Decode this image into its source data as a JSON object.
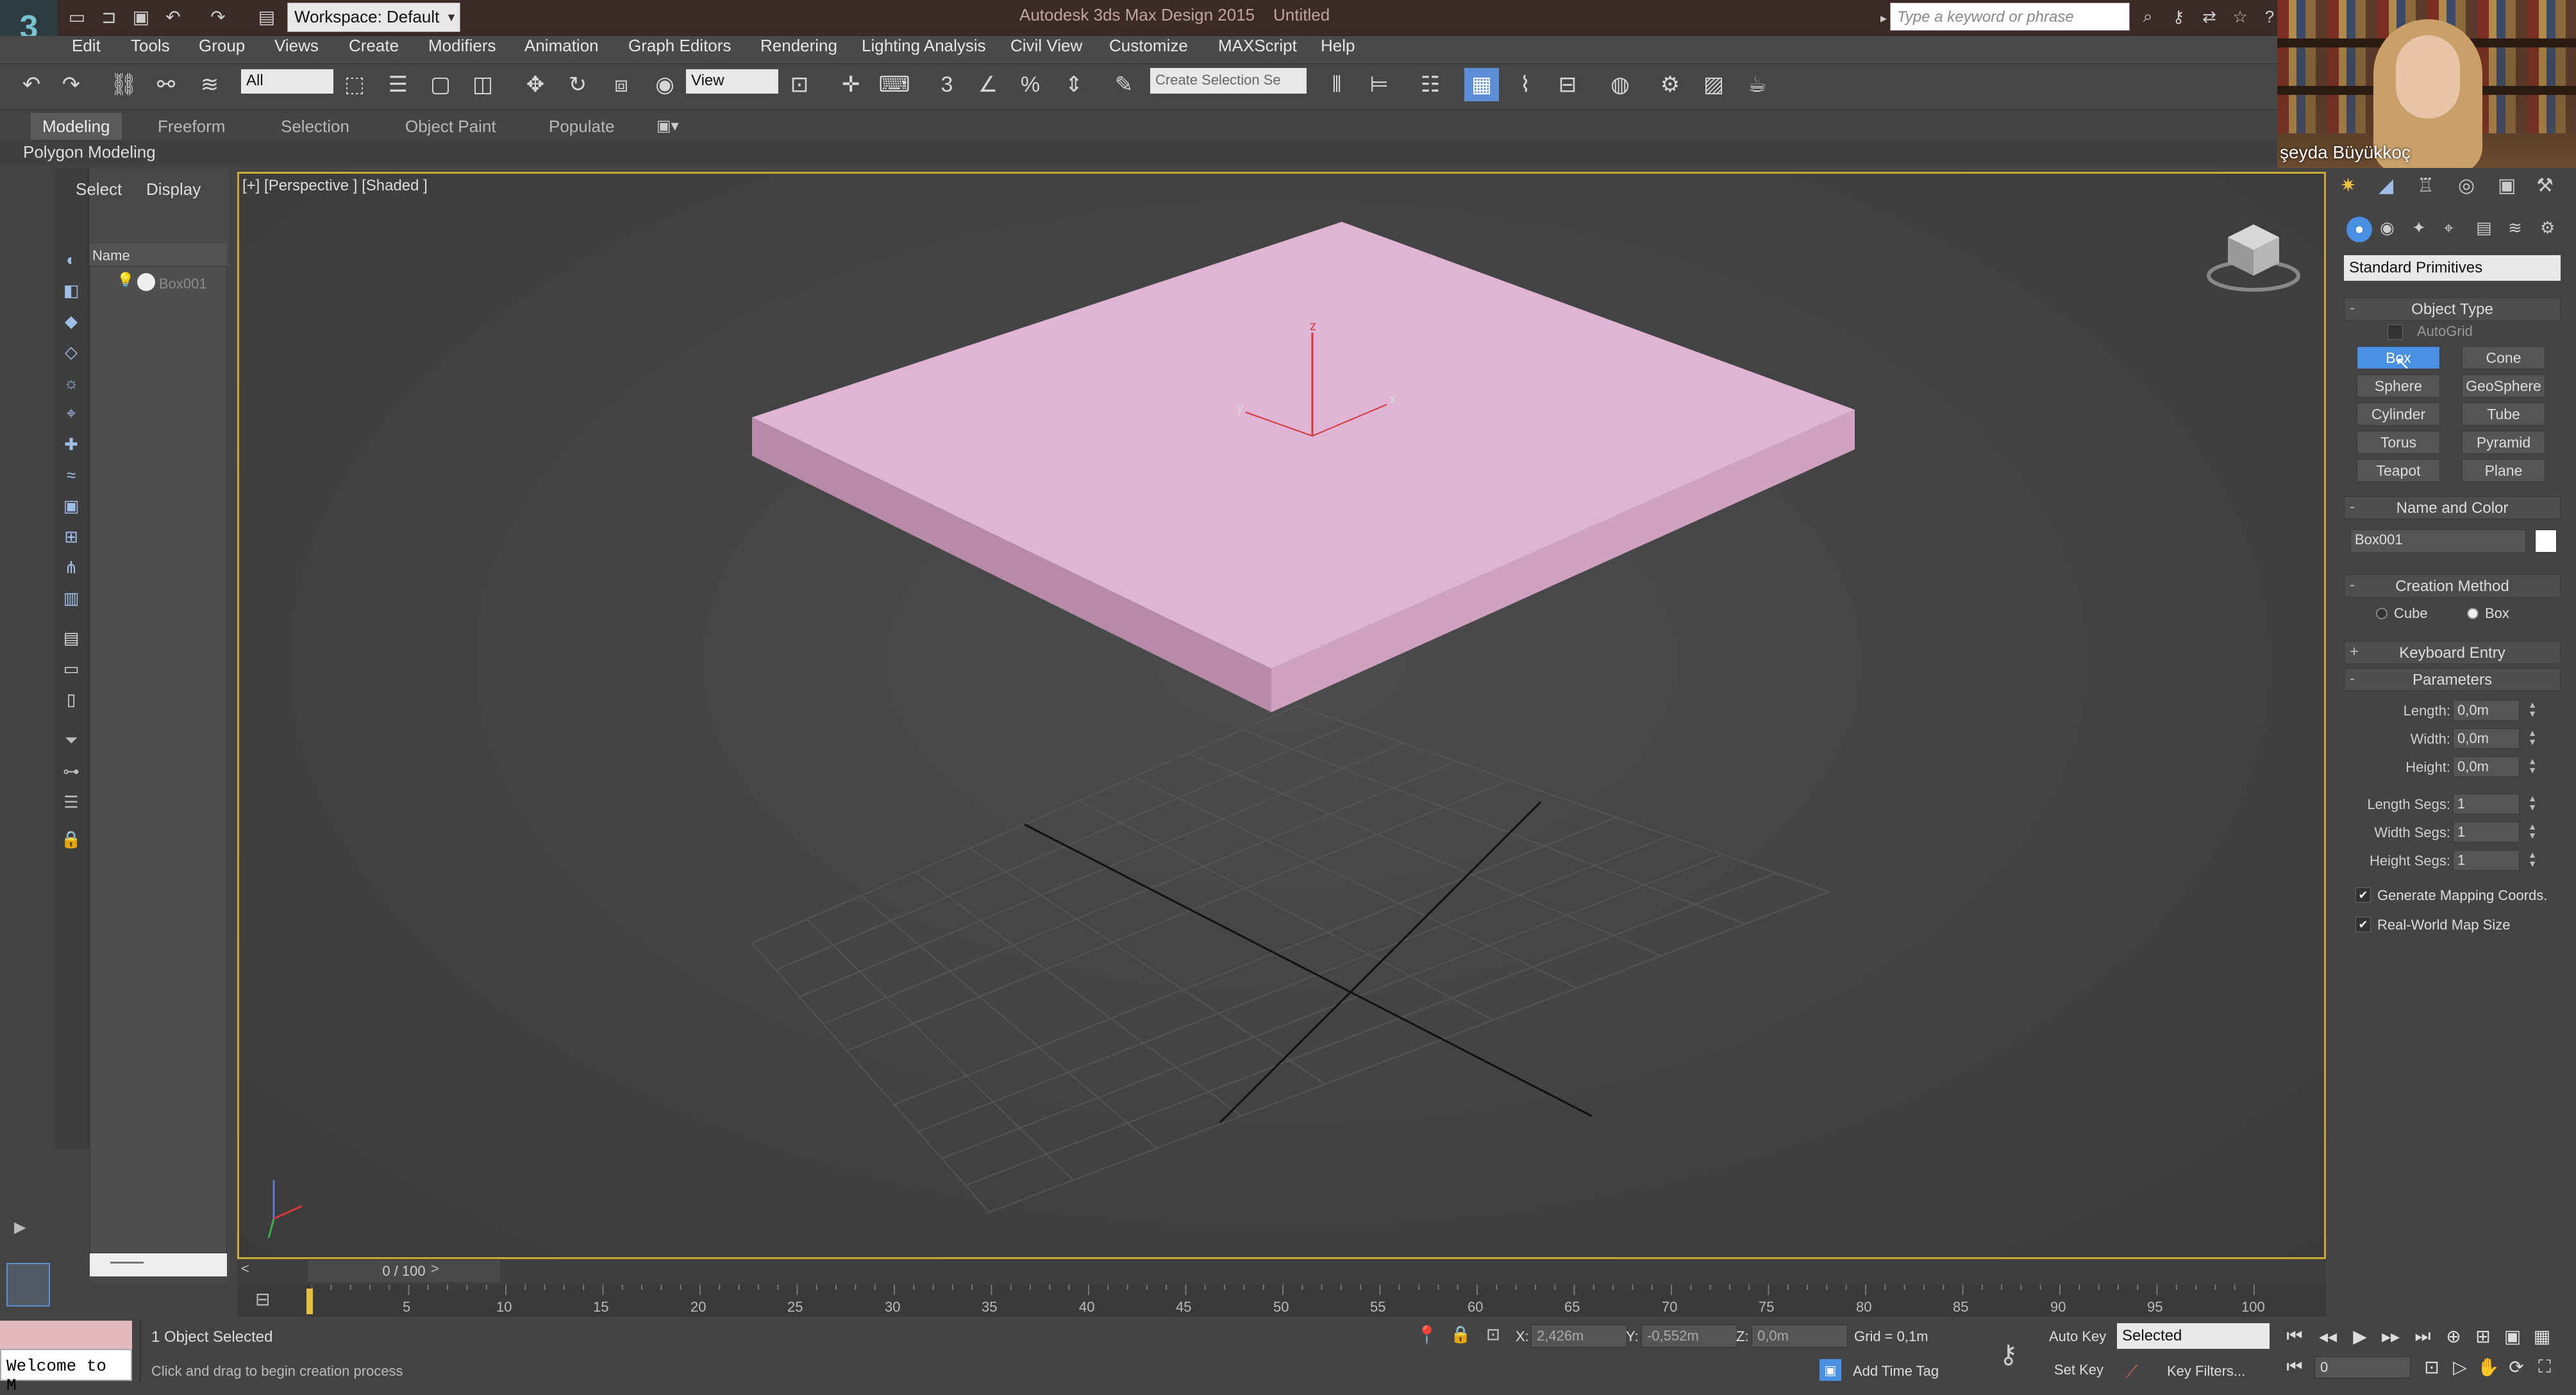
{
  "titlebar": {
    "app_title": "Autodesk 3ds Max Design 2015",
    "file_name": "Untitled",
    "workspace": "Workspace: Default",
    "search_placeholder": "Type a keyword or phrase"
  },
  "menu": [
    "Edit",
    "Tools",
    "Group",
    "Views",
    "Create",
    "Modifiers",
    "Animation",
    "Graph Editors",
    "Rendering",
    "Lighting Analysis",
    "Civil View",
    "Customize",
    "MAXScript",
    "Help"
  ],
  "toolbar": {
    "selection_filter": "All",
    "reference_coord": "View",
    "create_selection_set": "Create Selection Se",
    "snap_value": "3"
  },
  "ribbon": {
    "tabs": [
      "Modeling",
      "Freeform",
      "Selection",
      "Object Paint",
      "Populate"
    ],
    "panel_label": "Polygon Modeling"
  },
  "webcam": {
    "name": "şeyda Büyükkoç"
  },
  "scene_explorer": {
    "tab_select": "Select",
    "tab_display": "Display",
    "column_name": "Name",
    "objects": [
      "Box001"
    ]
  },
  "viewport": {
    "label": "[+] [Perspective ] [Shaded ]",
    "axis_x": "x",
    "axis_y": "y",
    "axis_z": "z",
    "object_color": "#e0b4d4"
  },
  "command_panel": {
    "category": "Standard Primitives",
    "object_type_title": "Object Type",
    "autogrid": "AutoGrid",
    "primitives": [
      "Box",
      "Cone",
      "Sphere",
      "GeoSphere",
      "Cylinder",
      "Tube",
      "Torus",
      "Pyramid",
      "Teapot",
      "Plane"
    ],
    "active_primitive": "Box",
    "name_color_title": "Name and Color",
    "object_name": "Box001",
    "creation_method_title": "Creation Method",
    "creation_cube": "Cube",
    "creation_box": "Box",
    "keyboard_entry_title": "Keyboard Entry",
    "parameters_title": "Parameters",
    "params": [
      {
        "label": "Length:",
        "value": "0,0m"
      },
      {
        "label": "Width:",
        "value": "0,0m"
      },
      {
        "label": "Height:",
        "value": "0,0m"
      },
      {
        "label": "Length Segs:",
        "value": "1"
      },
      {
        "label": "Width Segs:",
        "value": "1"
      },
      {
        "label": "Height Segs:",
        "value": "1"
      }
    ],
    "generate_mapping": "Generate Mapping Coords.",
    "real_world": "Real-World Map Size"
  },
  "timeline": {
    "slider_label": "0 / 100",
    "ticks": [
      "0",
      "5",
      "10",
      "15",
      "20",
      "25",
      "30",
      "35",
      "40",
      "45",
      "50",
      "55",
      "60",
      "65",
      "70",
      "75",
      "80",
      "85",
      "90",
      "95",
      "100"
    ],
    "current_frame": 0,
    "total_frames": 100
  },
  "status": {
    "welcome": "Welcome to M",
    "objects_selected": "1 Object Selected",
    "prompt": "Click and drag to begin creation process",
    "x_label": "X:",
    "x_value": "2,426m",
    "y_label": "Y:",
    "y_value": "-0,552m",
    "z_label": "Z:",
    "z_value": "0,0m",
    "grid": "Grid = 0,1m",
    "add_time_tag": "Add Time Tag",
    "auto_key": "Auto Key",
    "set_key": "Set Key",
    "selected_dropdown": "Selected",
    "key_filters": "Key Filters...",
    "frame": "0"
  }
}
